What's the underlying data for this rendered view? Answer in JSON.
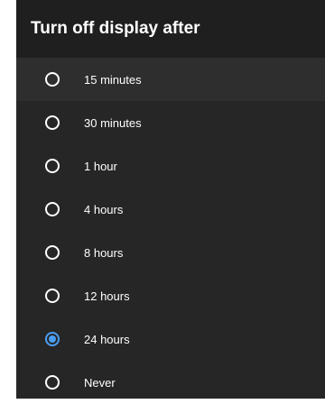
{
  "dialog": {
    "title": "Turn off display after",
    "accent_color": "#4a9ef4",
    "options": [
      {
        "label": "15 minutes",
        "selected": false,
        "focused": true
      },
      {
        "label": "30 minutes",
        "selected": false
      },
      {
        "label": "1 hour",
        "selected": false
      },
      {
        "label": "4 hours",
        "selected": false
      },
      {
        "label": "8 hours",
        "selected": false
      },
      {
        "label": "12 hours",
        "selected": false
      },
      {
        "label": "24 hours",
        "selected": true
      },
      {
        "label": "Never",
        "selected": false
      }
    ]
  }
}
